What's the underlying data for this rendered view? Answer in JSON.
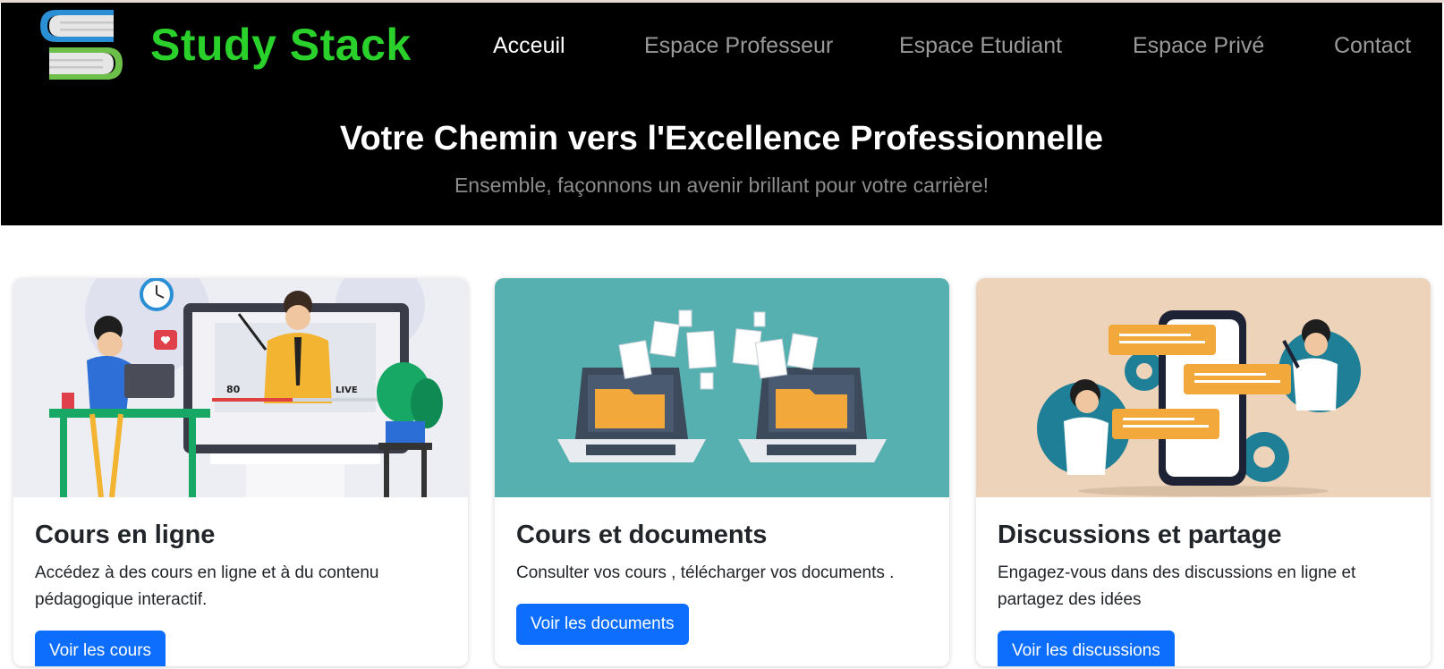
{
  "brand": {
    "name": "Study Stack",
    "color": "#2bd12b"
  },
  "nav": [
    {
      "label": "Acceuil",
      "active": true
    },
    {
      "label": "Espace Professeur",
      "active": false
    },
    {
      "label": "Espace Etudiant",
      "active": false
    },
    {
      "label": "Espace Privé",
      "active": false
    },
    {
      "label": "Contact",
      "active": false
    }
  ],
  "hero": {
    "title": "Votre Chemin vers l'Excellence Professionnelle",
    "subtitle": "Ensemble, façonnons un avenir brillant pour votre carrière!"
  },
  "cards": [
    {
      "title": "Cours en ligne",
      "text": "Accédez à des cours en ligne et à du contenu pédagogique interactif.",
      "button": "Voir les cours",
      "image": "online-course-illustration",
      "image_bg": "#eceef4"
    },
    {
      "title": "Cours et documents",
      "text": "Consulter vos cours , télécharger vos documents .",
      "button": "Voir les documents",
      "image": "file-transfer-illustration",
      "image_bg": "#56b0b0"
    },
    {
      "title": "Discussions et partage",
      "text": "Engagez-vous dans des discussions en ligne et partagez des idées",
      "button": "Voir les discussions",
      "image": "chat-discussion-illustration",
      "image_bg": "#ecd3b9"
    }
  ],
  "colors": {
    "primary": "#0d6efd",
    "header_bg": "#000000"
  }
}
